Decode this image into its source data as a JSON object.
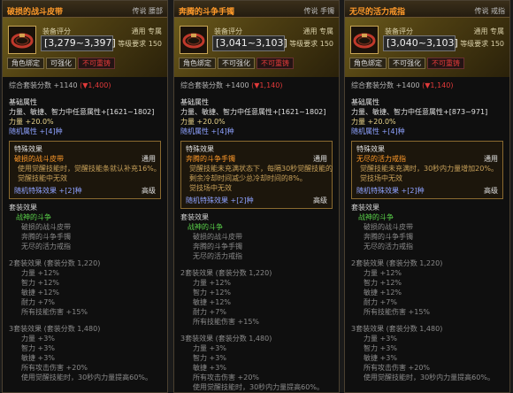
{
  "panels": [
    {
      "title": "破损的战斗皮带",
      "tag": "传说 腰部",
      "score_label": "装备评分",
      "class_label": "通用 专属",
      "score": "[3,279~3,397]",
      "level_label": "等级要求 150",
      "badges": [
        "角色绑定",
        "可强化",
        "不可重铸"
      ],
      "total_score": "综合套装分数 +1140",
      "total_delta": "(▼1,400)",
      "base_title": "基础属性",
      "base_stat": "力量、敏捷、智力中任意属性+[1621~1802]",
      "base_percent": "力量 +20.0%",
      "random_attr": "随机属性 +[4]种",
      "special_title": "特殊效果",
      "special_name": "破损的战斗皮带",
      "special_type": "通用",
      "special_desc": [
        "使用觉醒技能时，觉醒技能条就认补充16%。",
        "觉醒技能中无效"
      ],
      "random_special": "随机特殊效果 +[2]种",
      "random_special_rank": "高级",
      "set_title": "套装效果",
      "set_name": "战神的斗争",
      "set_items": [
        "破损的战斗皮带",
        "奔腾的斗争手镯",
        "无尽的活力戒指"
      ],
      "set2_title": "2套装效果 (套装分数 1,220)",
      "set2_lines": [
        "力量 +12%",
        "智力 +12%",
        "敏捷 +12%",
        "耐力 +7%",
        "所有技能伤害 +15%"
      ],
      "set3_title": "3套装效果 (套装分数 1,480)",
      "set3_lines": [
        "力量 +3%",
        "智力 +3%",
        "敏捷 +3%",
        "所有攻击伤害 +20%",
        "使用觉醒技能时，30秒内力量提高60%。"
      ]
    },
    {
      "title": "奔腾的斗争手镯",
      "tag": "传说 手镯",
      "score_label": "装备评分",
      "class_label": "通用 专属",
      "score": "[3,041~3,103]",
      "level_label": "等级要求 150",
      "badges": [
        "角色绑定",
        "不可强化",
        "不可重铸"
      ],
      "total_score": "综合套装分数 +1400",
      "total_delta": "(▼1,140)",
      "base_title": "基础属性",
      "base_stat": "力量、敏捷、智力中任意属性+[1621~1802]",
      "base_percent": "力量 +20.0%",
      "random_attr": "随机属性 +[4]种",
      "special_title": "特殊效果",
      "special_name": "奔腾的斗争手镯",
      "special_type": "通用",
      "special_desc": [
        "觉醒技能未充满状态下，每隔30秒觉醒技能的",
        "剩余冷却时间减少总冷却时间的8%。",
        "觉技场中无效"
      ],
      "random_special": "随机特殊效果 +[2]种",
      "random_special_rank": "高级",
      "set_title": "套装效果",
      "set_name": "战神的斗争",
      "set_items": [
        "破损的战斗皮带",
        "奔腾的斗争手镯",
        "无尽的活力戒指"
      ],
      "set2_title": "2套装效果 (套装分数 1,220)",
      "set2_lines": [
        "力量 +12%",
        "智力 +12%",
        "敏捷 +12%",
        "耐力 +7%",
        "所有技能伤害 +15%"
      ],
      "set3_title": "3套装效果 (套装分数 1,480)",
      "set3_lines": [
        "力量 +3%",
        "智力 +3%",
        "敏捷 +3%",
        "所有攻击伤害 +20%",
        "使用觉醒技能时，30秒内力量提高60%。"
      ]
    },
    {
      "title": "无尽的活力戒指",
      "tag": "传说 戒指",
      "score_label": "装备评分",
      "class_label": "通用 专属",
      "score": "[3,040~3,103]",
      "level_label": "等级要求 150",
      "badges": [
        "角色绑定",
        "不可强化",
        "不可重铸"
      ],
      "total_score": "综合套装分数 +1400",
      "total_delta": "(▼1,140)",
      "base_title": "基础属性",
      "base_stat": "力量、敏捷、智力中任意属性+[873~971]",
      "base_percent": "力量 +20.0%",
      "random_attr": "随机属性 +[4]种",
      "special_title": "特殊效果",
      "special_name": "无尽的活力戒指",
      "special_type": "通用",
      "special_desc": [
        "觉醒技能未充满时，30秒内力量增加20%。",
        "觉技场中无效"
      ],
      "random_special": "随机特殊效果 +[2]种",
      "random_special_rank": "高级",
      "set_title": "套装效果",
      "set_name": "战神的斗争",
      "set_items": [
        "破损的战斗皮带",
        "奔腾的斗争手镯",
        "无尽的活力戒指"
      ],
      "set2_title": "2套装效果 (套装分数 1,220)",
      "set2_lines": [
        "力量 +12%",
        "智力 +12%",
        "敏捷 +12%",
        "耐力 +7%",
        "所有技能伤害 +15%"
      ],
      "set3_title": "3套装效果 (套装分数 1,480)",
      "set3_lines": [
        "力量 +3%",
        "智力 +3%",
        "敏捷 +3%",
        "所有攻击伤害 +20%",
        "使用觉醒技能时，30秒内力量提高60%。"
      ]
    }
  ]
}
